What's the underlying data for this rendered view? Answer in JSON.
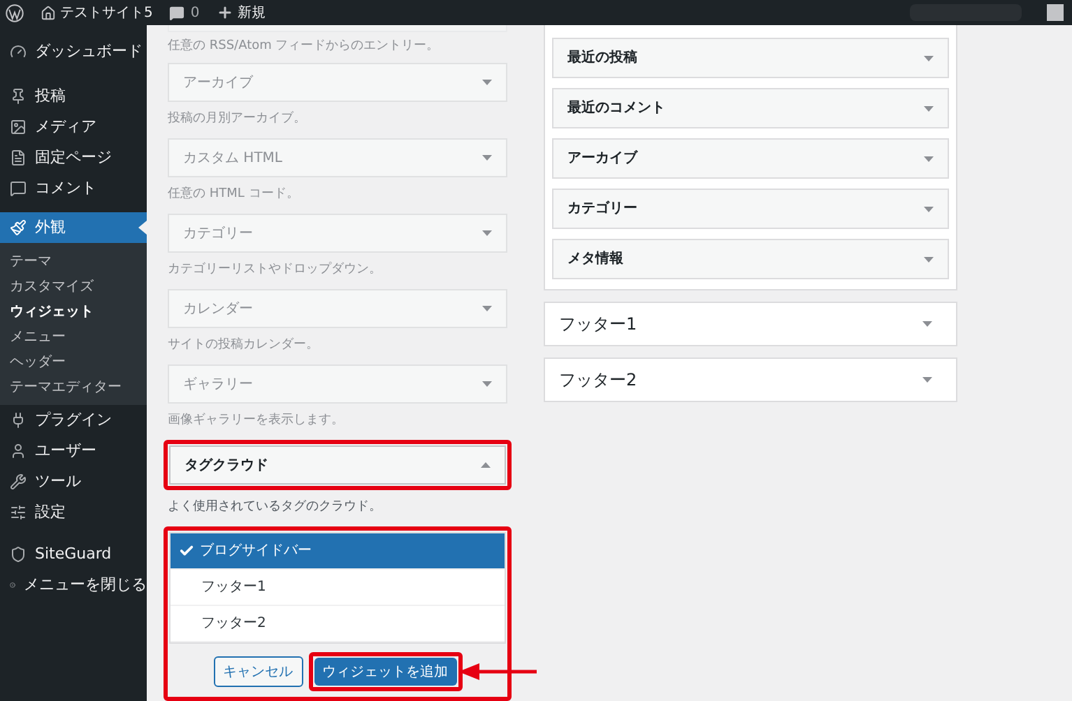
{
  "admin_bar": {
    "site_name": "テストサイト5",
    "comment_count": "0",
    "new_label": "新規"
  },
  "sidebar": {
    "items": [
      {
        "label": "ダッシュボード",
        "selected": false
      },
      {
        "label": "投稿",
        "selected": false
      },
      {
        "label": "メディア",
        "selected": false
      },
      {
        "label": "固定ページ",
        "selected": false
      },
      {
        "label": "コメント",
        "selected": false
      },
      {
        "label": "外観",
        "selected": true,
        "children": [
          {
            "label": "テーマ",
            "selected": false
          },
          {
            "label": "カスタマイズ",
            "selected": false
          },
          {
            "label": "ウィジェット",
            "selected": true
          },
          {
            "label": "メニュー",
            "selected": false
          },
          {
            "label": "ヘッダー",
            "selected": false
          },
          {
            "label": "テーマエディター",
            "selected": false
          }
        ]
      },
      {
        "label": "プラグイン",
        "selected": false
      },
      {
        "label": "ユーザー",
        "selected": false
      },
      {
        "label": "ツール",
        "selected": false
      },
      {
        "label": "設定",
        "selected": false
      },
      {
        "label": "SiteGuard",
        "selected": false
      },
      {
        "label": "メニューを閉じる",
        "selected": false
      }
    ]
  },
  "available_widgets": {
    "top_description": "任意の RSS/Atom フィードからのエントリー。",
    "widgets": [
      {
        "title": "アーカイブ",
        "description": "投稿の月別アーカイブ。",
        "disabled": true,
        "expanded": false,
        "highlighted": false
      },
      {
        "title": "カスタム HTML",
        "description": "任意の HTML コード。",
        "disabled": true,
        "expanded": false,
        "highlighted": false
      },
      {
        "title": "カテゴリー",
        "description": "カテゴリーリストやドロップダウン。",
        "disabled": true,
        "expanded": false,
        "highlighted": false
      },
      {
        "title": "カレンダー",
        "description": "サイトの投稿カレンダー。",
        "disabled": true,
        "expanded": false,
        "highlighted": false
      },
      {
        "title": "ギャラリー",
        "description": "画像ギャラリーを表示します。",
        "disabled": true,
        "expanded": false,
        "highlighted": false
      },
      {
        "title": "タグクラウド",
        "description": "よく使用されているタグのクラウド。",
        "disabled": false,
        "expanded": true,
        "highlighted": true
      }
    ],
    "chooser": {
      "highlighted": true,
      "areas": [
        {
          "label": "ブログサイドバー",
          "selected": true
        },
        {
          "label": "フッター1",
          "selected": false
        },
        {
          "label": "フッター2",
          "selected": false
        }
      ],
      "cancel_label": "キャンセル",
      "add_label": "ウィジェットを追加",
      "add_highlighted": true
    }
  },
  "widget_areas": [
    {
      "expanded": true,
      "widgets": [
        "最近の投稿",
        "最近のコメント",
        "アーカイブ",
        "カテゴリー",
        "メタ情報"
      ]
    },
    {
      "title": "フッター1",
      "expanded": false
    },
    {
      "title": "フッター2",
      "expanded": false
    }
  ]
}
